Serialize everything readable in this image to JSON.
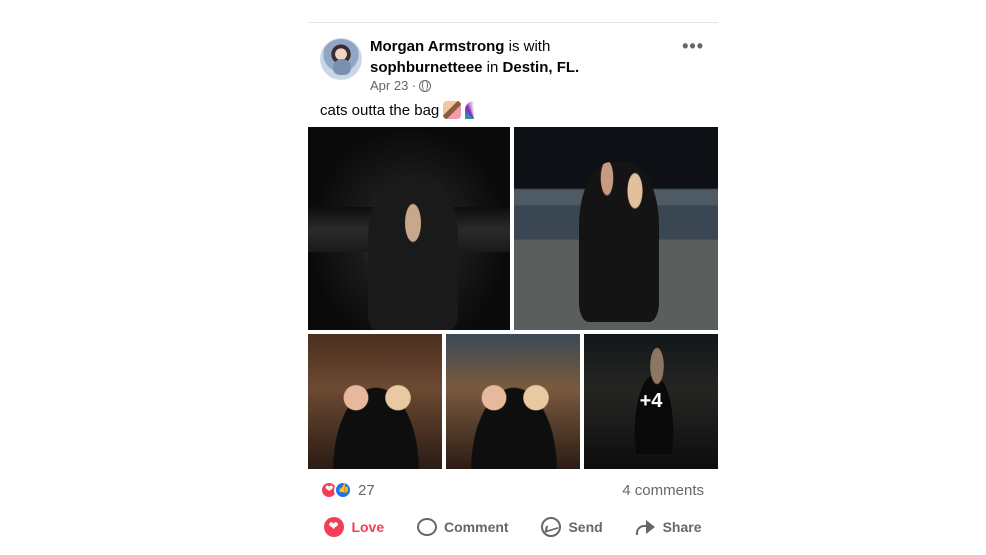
{
  "post": {
    "author": "Morgan Armstrong",
    "with_text": " is with ",
    "tagged_user": "sophburnetteee",
    "in_text": " in ",
    "location": "Destin, FL.",
    "date": "Apr 23 ·",
    "privacy_icon": "globe-icon",
    "more_icon": "more-options-icon",
    "more_glyph": "•••",
    "caption": "cats outta the bag",
    "caption_emojis": [
      "kiss-emoji",
      "rainbow-emoji"
    ],
    "photos": [
      {
        "name": "photo-1",
        "overlay": ""
      },
      {
        "name": "photo-2",
        "overlay": ""
      },
      {
        "name": "photo-3",
        "overlay": ""
      },
      {
        "name": "photo-4",
        "overlay": ""
      },
      {
        "name": "photo-5",
        "overlay": "+4"
      }
    ],
    "reaction_count": "27",
    "comments_count": "4 comments"
  },
  "actions": {
    "love_label": "Love",
    "comment_label": "Comment",
    "send_label": "Send",
    "share_label": "Share"
  },
  "colors": {
    "love": "#f33e58",
    "like": "#1877f2",
    "secondary_text": "#65676b"
  }
}
